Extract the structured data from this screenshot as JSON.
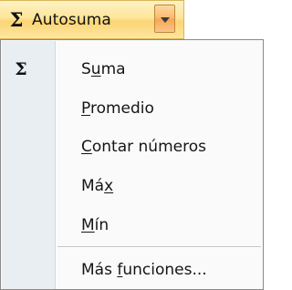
{
  "toolbar": {
    "sigma_symbol": "Σ",
    "autosum_label": "Autosuma",
    "dropdown_icon": "chevron-down-icon"
  },
  "menu": {
    "sigma_symbol": "Σ",
    "items": [
      {
        "pre": "S",
        "mnemonic": "u",
        "post": "ma",
        "full": "Suma"
      },
      {
        "pre": "",
        "mnemonic": "P",
        "post": "romedio",
        "full": "Promedio"
      },
      {
        "pre": "",
        "mnemonic": "C",
        "post": "ontar números",
        "full": "Contar números"
      },
      {
        "pre": "Má",
        "mnemonic": "x",
        "post": "",
        "full": "Máx"
      },
      {
        "pre": "",
        "mnemonic": "M",
        "post": "ín",
        "full": "Mín"
      },
      {
        "pre": "Más ",
        "mnemonic": "f",
        "post": "unciones...",
        "full": "Más funciones..."
      }
    ]
  },
  "colors": {
    "button_highlight": "#fde59a",
    "dropdown_highlight": "#f9b76b",
    "menu_background": "#fafafa",
    "gutter_background": "#e9eef2"
  }
}
